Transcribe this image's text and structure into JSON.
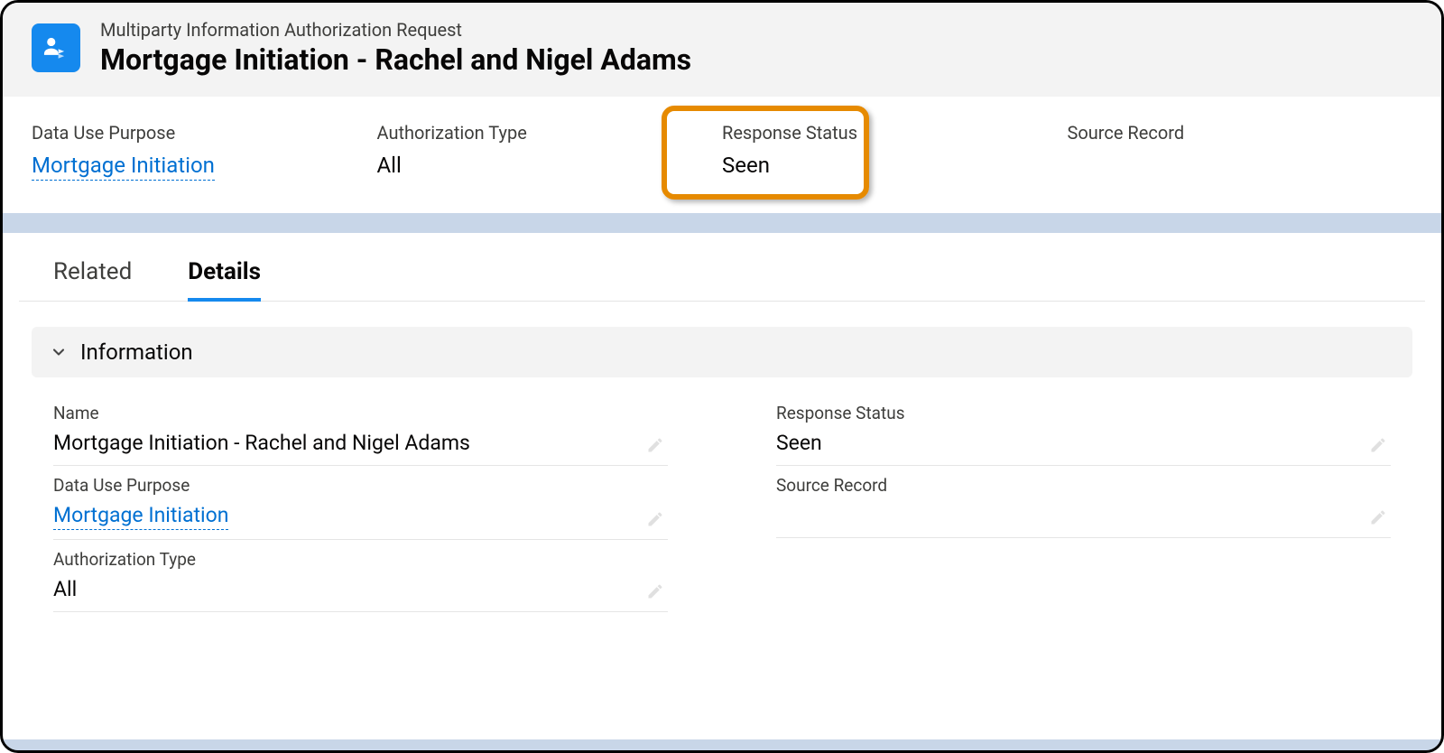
{
  "header": {
    "subtitle": "Multiparty Information Authorization Request",
    "title": "Mortgage Initiation - Rachel and Nigel Adams"
  },
  "summary": {
    "data_use_purpose": {
      "label": "Data Use Purpose",
      "value": "Mortgage Initiation"
    },
    "authorization_type": {
      "label": "Authorization Type",
      "value": "All"
    },
    "response_status": {
      "label": "Response Status",
      "value": "Seen"
    },
    "source_record": {
      "label": "Source Record",
      "value": ""
    }
  },
  "tabs": {
    "related": "Related",
    "details": "Details"
  },
  "section": {
    "information": "Information"
  },
  "details": {
    "left": {
      "name": {
        "label": "Name",
        "value": "Mortgage Initiation - Rachel and Nigel Adams"
      },
      "data_use_purpose": {
        "label": "Data Use Purpose",
        "value": "Mortgage Initiation"
      },
      "authorization_type": {
        "label": "Authorization Type",
        "value": "All"
      }
    },
    "right": {
      "response_status": {
        "label": "Response Status",
        "value": "Seen"
      },
      "source_record": {
        "label": "Source Record",
        "value": ""
      }
    }
  }
}
